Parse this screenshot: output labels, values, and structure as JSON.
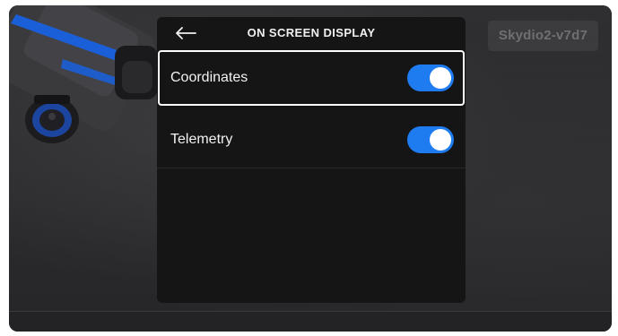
{
  "header": {
    "title": "ON SCREEN DISPLAY",
    "back_icon": "arrow-left-icon"
  },
  "device": {
    "name": "Skydio2-v7d7"
  },
  "settings": [
    {
      "label": "Coordinates",
      "enabled": true,
      "selected": true
    },
    {
      "label": "Telemetry",
      "enabled": true,
      "selected": false
    }
  ],
  "colors": {
    "accent": "#1e7cf0",
    "panel": "#151516",
    "background": "#2e2e30",
    "text": "#f2f2f2"
  }
}
